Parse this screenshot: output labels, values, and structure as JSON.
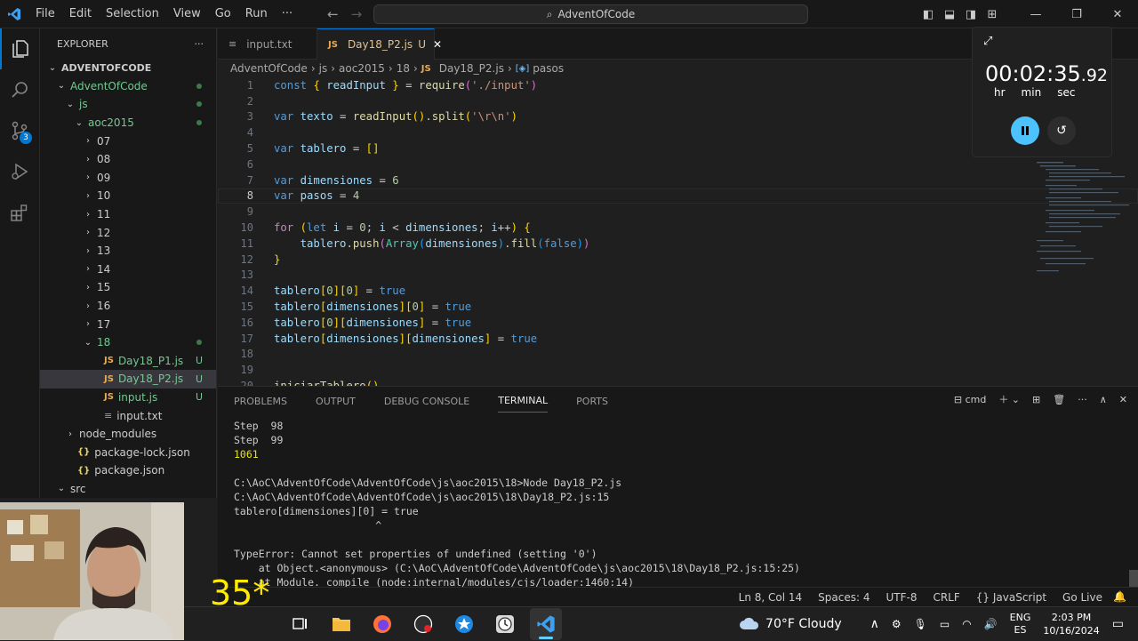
{
  "titlebar": {
    "menu": [
      "File",
      "Edit",
      "Selection",
      "View",
      "Go",
      "Run",
      "···"
    ],
    "search": "AdventOfCode"
  },
  "explorer": {
    "title": "EXPLORER",
    "more": "···",
    "items": [
      {
        "label": "ADVENTOFCODE",
        "depth": 0,
        "chev": "⌄",
        "bold": true
      },
      {
        "label": "AdventOfCode",
        "depth": 1,
        "chev": "⌄",
        "dot": true,
        "color": "#73c991"
      },
      {
        "label": "js",
        "depth": 2,
        "chev": "⌄",
        "dot": true,
        "color": "#73c991"
      },
      {
        "label": "aoc2015",
        "depth": 3,
        "chev": "⌄",
        "dot": true,
        "color": "#73c991"
      },
      {
        "label": "07",
        "depth": 4,
        "chev": "›"
      },
      {
        "label": "08",
        "depth": 4,
        "chev": "›"
      },
      {
        "label": "09",
        "depth": 4,
        "chev": "›"
      },
      {
        "label": "10",
        "depth": 4,
        "chev": "›"
      },
      {
        "label": "11",
        "depth": 4,
        "chev": "›"
      },
      {
        "label": "12",
        "depth": 4,
        "chev": "›"
      },
      {
        "label": "13",
        "depth": 4,
        "chev": "›"
      },
      {
        "label": "14",
        "depth": 4,
        "chev": "›"
      },
      {
        "label": "15",
        "depth": 4,
        "chev": "›"
      },
      {
        "label": "16",
        "depth": 4,
        "chev": "›"
      },
      {
        "label": "17",
        "depth": 4,
        "chev": "›"
      },
      {
        "label": "18",
        "depth": 4,
        "chev": "⌄",
        "dot": true,
        "color": "#73c991"
      },
      {
        "label": "Day18_P1.js",
        "depth": 5,
        "icon": "JS",
        "flag": "U",
        "color": "#73c991"
      },
      {
        "label": "Day18_P2.js",
        "depth": 5,
        "icon": "JS",
        "flag": "U",
        "color": "#73c991",
        "sel": true
      },
      {
        "label": "input.js",
        "depth": 5,
        "icon": "JS",
        "flag": "U",
        "color": "#73c991"
      },
      {
        "label": "input.txt",
        "depth": 5,
        "icon": "≡"
      },
      {
        "label": "node_modules",
        "depth": 2,
        "chev": "›"
      },
      {
        "label": "package-lock.json",
        "depth": 2,
        "icon": "{}"
      },
      {
        "label": "package.json",
        "depth": 2,
        "icon": "{}"
      },
      {
        "label": "src",
        "depth": 1,
        "chev": "⌄"
      }
    ]
  },
  "tabs": [
    {
      "label": "input.txt",
      "icon": "≡"
    },
    {
      "label": "Day18_P2.js",
      "icon": "JS",
      "flag": "U"
    }
  ],
  "breadcrumb": [
    "AdventOfCode",
    "js",
    "aoc2015",
    "18",
    "Day18_P2.js",
    "pasos"
  ],
  "code_lines": [
    {
      "n": "1",
      "html": "<span class='kw'>const</span> <span class='br1'>{</span> <span class='vr'>readInput</span> <span class='br1'>}</span> = <span class='fn'>require</span><span class='br2'>(</span><span class='st'>'./input'</span><span class='br2'>)</span>"
    },
    {
      "n": "2",
      "html": ""
    },
    {
      "n": "3",
      "html": "<span class='kw'>var</span> <span class='vr'>texto</span> = <span class='fn'>readInput</span><span class='br1'>()</span>.<span class='fn'>split</span><span class='br1'>(</span><span class='st'>'\\r\\n'</span><span class='br1'>)</span>"
    },
    {
      "n": "4",
      "html": ""
    },
    {
      "n": "5",
      "html": "<span class='kw'>var</span> <span class='vr'>tablero</span> = <span class='br1'>[]</span>"
    },
    {
      "n": "6",
      "html": ""
    },
    {
      "n": "7",
      "html": "<span class='kw'>var</span> <span class='vr'>dimensiones</span> = <span class='nm'>6</span>"
    },
    {
      "n": "8",
      "html": "<span class='kw'>var</span> <span class='vr'>pasos</span> = <span class='nm'>4</span>",
      "cur": true
    },
    {
      "n": "9",
      "html": ""
    },
    {
      "n": "10",
      "html": "<span class='ctl'>for</span> <span class='br1'>(</span><span class='kw'>let</span> <span class='vr'>i</span> = <span class='nm'>0</span>; <span class='vr'>i</span> &lt; <span class='vr'>dimensiones</span>; <span class='vr'>i</span>++<span class='br1'>)</span> <span class='br1'>{</span>"
    },
    {
      "n": "11",
      "html": "    <span class='vr'>tablero</span>.<span class='fn'>push</span><span class='br2'>(</span><span class='cl'>Array</span><span class='br3'>(</span><span class='vr'>dimensiones</span><span class='br3'>)</span>.<span class='fn'>fill</span><span class='br3'>(</span><span class='bool'>false</span><span class='br3'>)</span><span class='br2'>)</span>"
    },
    {
      "n": "12",
      "html": "<span class='br1'>}</span>"
    },
    {
      "n": "13",
      "html": ""
    },
    {
      "n": "14",
      "html": "<span class='vr'>tablero</span><span class='br1'>[</span><span class='nm'>0</span><span class='br1'>][</span><span class='nm'>0</span><span class='br1'>]</span> = <span class='bool'>true</span>"
    },
    {
      "n": "15",
      "html": "<span class='vr'>tablero</span><span class='br1'>[</span><span class='vr'>dimensiones</span><span class='br1'>][</span><span class='nm'>0</span><span class='br1'>]</span> = <span class='bool'>true</span>"
    },
    {
      "n": "16",
      "html": "<span class='vr'>tablero</span><span class='br1'>[</span><span class='nm'>0</span><span class='br1'>][</span><span class='vr'>dimensiones</span><span class='br1'>]</span> = <span class='bool'>true</span>"
    },
    {
      "n": "17",
      "html": "<span class='vr'>tablero</span><span class='br1'>[</span><span class='vr'>dimensiones</span><span class='br1'>][</span><span class='vr'>dimensiones</span><span class='br1'>]</span> = <span class='bool'>true</span>"
    },
    {
      "n": "18",
      "html": ""
    },
    {
      "n": "19",
      "html": ""
    },
    {
      "n": "20",
      "html": "<span class='fn'>iniciarTablero</span><span class='br1'>()</span>"
    }
  ],
  "timer": {
    "time": "00:02:35",
    "fraction": ".92",
    "units": [
      "hr",
      "min",
      "sec"
    ]
  },
  "panel": {
    "tabs": [
      "PROBLEMS",
      "OUTPUT",
      "DEBUG CONSOLE",
      "TERMINAL",
      "PORTS"
    ],
    "active": "TERMINAL",
    "shell": "cmd"
  },
  "terminal": [
    {
      "t": "Step  98"
    },
    {
      "t": "Step  99"
    },
    {
      "t": "1061",
      "yl": true
    },
    {
      "t": ""
    },
    {
      "t": "C:\\AoC\\AdventOfCode\\AdventOfCode\\js\\aoc2015\\18>Node Day18_P2.js"
    },
    {
      "t": "C:\\AoC\\AdventOfCode\\AdventOfCode\\js\\aoc2015\\18\\Day18_P2.js:15"
    },
    {
      "t": "tablero[dimensiones][0] = true"
    },
    {
      "t": "                       ^"
    },
    {
      "t": ""
    },
    {
      "t": "TypeError: Cannot set properties of undefined (setting '0')"
    },
    {
      "t": "    at Object.<anonymous> (C:\\AoC\\AdventOfCode\\AdventOfCode\\js\\aoc2015\\18\\Day18_P2.js:15:25)"
    },
    {
      "t": "    at Module._compile (node:internal/modules/cjs/loader:1460:14)"
    }
  ],
  "status": [
    "Ln 8, Col 14",
    "Spaces: 4",
    "UTF-8",
    "CRLF",
    "{} JavaScript",
    "Go Live"
  ],
  "taskbar": {
    "weather": "70°F  Cloudy",
    "lang1": "ENG",
    "lang2": "ES",
    "time": "2:03 PM",
    "date": "10/16/2024"
  },
  "overlay": "35*"
}
